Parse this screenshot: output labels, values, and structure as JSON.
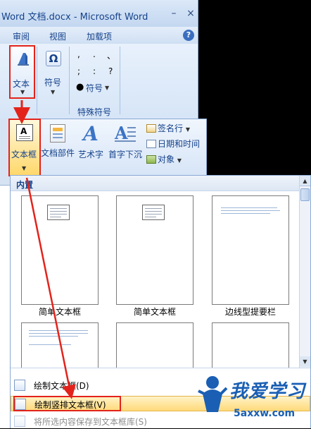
{
  "window": {
    "title": "Word 文档.docx - Microsoft Word",
    "minimize": "–",
    "close": "×"
  },
  "ribbon_tabs": [
    "审阅",
    "视图",
    "加载项"
  ],
  "help_label": "?",
  "ribbon": {
    "text_button": "文本",
    "symbol_button": "符号",
    "special_symbols_group": "特殊符号",
    "special_grid": [
      ",",
      ".",
      "、",
      ";",
      ":",
      "?"
    ],
    "special_symbol_label": "符号"
  },
  "insert_bar": {
    "textbox": "文本框",
    "quick_parts": "文档部件",
    "wordart": "艺术字",
    "dropcap": "首字下沉",
    "signature_line": "签名行",
    "date_time": "日期和时间",
    "object": "对象"
  },
  "gallery": {
    "header": "内置",
    "items": [
      {
        "label": "简单文本框"
      },
      {
        "label": "简单文本框"
      },
      {
        "label": "边线型提要栏"
      }
    ]
  },
  "menu": {
    "draw_textbox": "绘制文本框(D)",
    "draw_vertical_textbox": "绘制竖排文本框(V)",
    "save_selection": "将所选内容保存到文本框库(S)"
  },
  "watermark": {
    "text": "我爱学习",
    "url": "5axxw.com"
  },
  "colors": {
    "highlight_red": "#e3231b",
    "ribbon_blue": "#15428b",
    "hover_orange": "#ffd97a"
  }
}
